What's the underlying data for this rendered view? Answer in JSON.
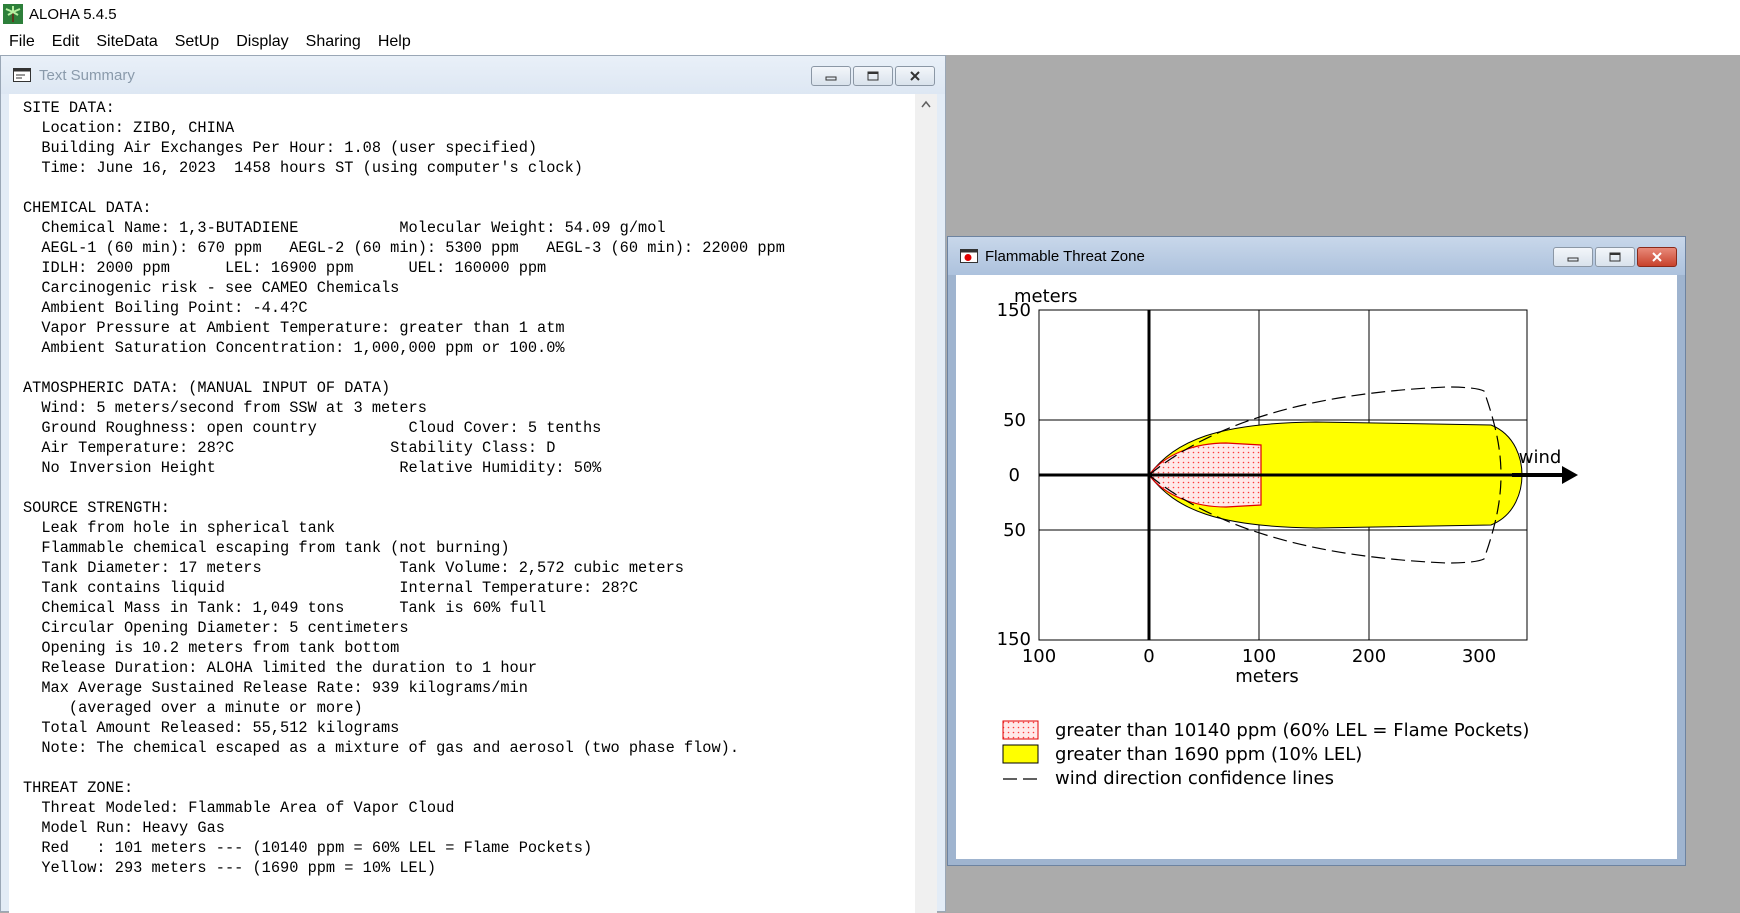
{
  "app": {
    "title": "ALOHA 5.4.5",
    "menu": [
      "File",
      "Edit",
      "SiteData",
      "SetUp",
      "Display",
      "Sharing",
      "Help"
    ]
  },
  "text_summary": {
    "title": "Text Summary",
    "lines": [
      "SITE DATA:",
      "  Location: ZIBO, CHINA",
      "  Building Air Exchanges Per Hour: 1.08 (user specified)",
      "  Time: June 16, 2023  1458 hours ST (using computer's clock)",
      "",
      "CHEMICAL DATA:",
      "  Chemical Name: 1,3-BUTADIENE           Molecular Weight: 54.09 g/mol",
      "  AEGL-1 (60 min): 670 ppm   AEGL-2 (60 min): 5300 ppm   AEGL-3 (60 min): 22000 ppm",
      "  IDLH: 2000 ppm      LEL: 16900 ppm      UEL: 160000 ppm",
      "  Carcinogenic risk - see CAMEO Chemicals",
      "  Ambient Boiling Point: -4.4?C",
      "  Vapor Pressure at Ambient Temperature: greater than 1 atm",
      "  Ambient Saturation Concentration: 1,000,000 ppm or 100.0%",
      "",
      "ATMOSPHERIC DATA: (MANUAL INPUT OF DATA)",
      "  Wind: 5 meters/second from SSW at 3 meters",
      "  Ground Roughness: open country          Cloud Cover: 5 tenths",
      "  Air Temperature: 28?C                 Stability Class: D",
      "  No Inversion Height                    Relative Humidity: 50%",
      "",
      "SOURCE STRENGTH:",
      "  Leak from hole in spherical tank",
      "  Flammable chemical escaping from tank (not burning)",
      "  Tank Diameter: 17 meters               Tank Volume: 2,572 cubic meters",
      "  Tank contains liquid                   Internal Temperature: 28?C",
      "  Chemical Mass in Tank: 1,049 tons      Tank is 60% full",
      "  Circular Opening Diameter: 5 centimeters",
      "  Opening is 10.2 meters from tank bottom",
      "  Release Duration: ALOHA limited the duration to 1 hour",
      "  Max Average Sustained Release Rate: 939 kilograms/min",
      "     (averaged over a minute or more)",
      "  Total Amount Released: 55,512 kilograms",
      "  Note: The chemical escaped as a mixture of gas and aerosol (two phase flow).",
      "",
      "THREAT ZONE:",
      "  Threat Modeled: Flammable Area of Vapor Cloud",
      "  Model Run: Heavy Gas",
      "  Red   : 101 meters --- (10140 ppm = 60% LEL = Flame Pockets)",
      "  Yellow: 293 meters --- (1690 ppm = 10% LEL)"
    ]
  },
  "threat_zone": {
    "title": "Flammable Threat Zone",
    "y_unit": "meters",
    "x_unit": "meters",
    "y_ticks": [
      "150",
      "50",
      "0",
      "50",
      "150"
    ],
    "x_ticks": [
      "100",
      "0",
      "100",
      "200",
      "300"
    ],
    "wind_label": "wind",
    "legend": [
      {
        "label": "greater than 10140 ppm (60% LEL = Flame Pockets)",
        "color": "#ff2a2a",
        "fill": "#ffd6d6"
      },
      {
        "label": "greater than 1690 ppm (10% LEL)",
        "color": "#000000",
        "fill": "#ffff00"
      },
      {
        "label": "wind direction confidence lines",
        "color": "#000000",
        "fill": "none"
      }
    ],
    "zones": {
      "red_m": 101,
      "yellow_m": 293
    }
  }
}
